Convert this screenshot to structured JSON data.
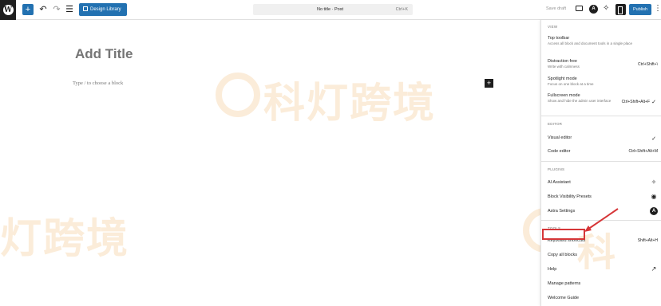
{
  "toolbar": {
    "design_library": "Design Library",
    "command": {
      "title": "No title · Post",
      "shortcut": "Ctrl+K"
    },
    "save_draft": "Save draft",
    "publish": "Publish",
    "astra_letter": "A"
  },
  "editor": {
    "title_placeholder": "Add Title",
    "block_placeholder": "Type / to choose a block"
  },
  "watermark": {
    "text_top": "科灯跨境",
    "text_bottom": "灯跨境",
    "text_right": "科"
  },
  "menu": {
    "view": {
      "heading": "VIEW",
      "items": [
        {
          "label": "Top toolbar",
          "desc": "Access all block and document tools in a single place",
          "shortcut": ""
        },
        {
          "label": "Distraction free",
          "desc": "Write with calmness",
          "shortcut": "Ctrl+Shift+\\"
        },
        {
          "label": "Spotlight mode",
          "desc": "Focus on one block at a time",
          "shortcut": ""
        },
        {
          "label": "Fullscreen mode",
          "desc": "Show and hide the admin user interface",
          "shortcut": "Ctrl+Shift+Alt+F",
          "checked": true
        }
      ]
    },
    "editor": {
      "heading": "EDITOR",
      "items": [
        {
          "label": "Visual editor",
          "checked": true
        },
        {
          "label": "Code editor",
          "shortcut": "Ctrl+Shift+Alt+M"
        }
      ]
    },
    "plugins": {
      "heading": "PLUGINS",
      "items": [
        {
          "label": "AI Assistant",
          "icon": "sparkle-icon"
        },
        {
          "label": "Block Visibility Presets",
          "icon": "eye-icon"
        },
        {
          "label": "Astra Settings",
          "icon": "astra-icon"
        }
      ]
    },
    "tools": {
      "heading": "TOOLS",
      "items": [
        {
          "label": "Keyboard shortcuts",
          "shortcut": "Shift+Alt+H"
        },
        {
          "label": "Copy all blocks"
        },
        {
          "label": "Help",
          "icon": "external-link-icon"
        },
        {
          "label": "Manage patterns"
        },
        {
          "label": "Welcome Guide"
        }
      ]
    }
  },
  "colors": {
    "accent": "#2271b1",
    "highlight": "#d63638",
    "watermark": "#ecaa50"
  }
}
